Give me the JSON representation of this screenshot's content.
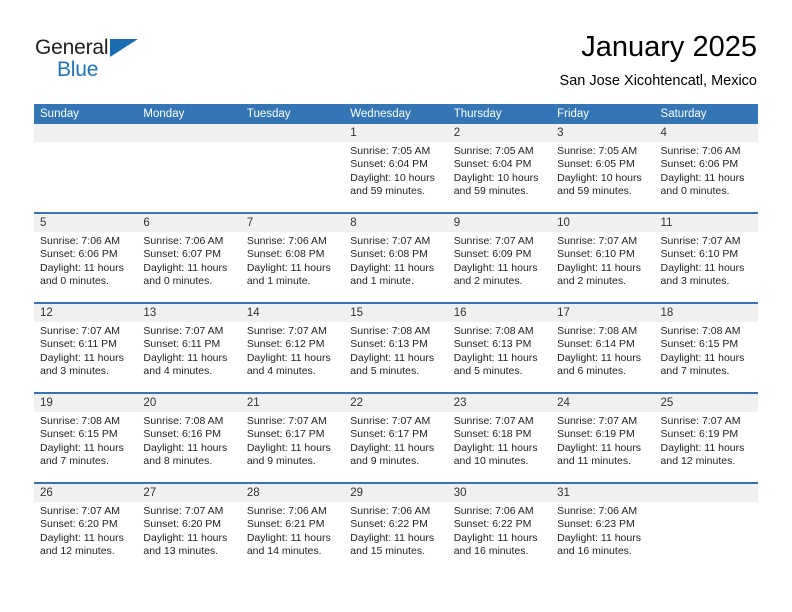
{
  "branding": {
    "name_part1": "General",
    "name_part2": "Blue",
    "triangle_color": "#1b6cb0",
    "blue_text_color": "#1b75bb"
  },
  "header": {
    "title": "January 2025",
    "subtitle": "San Jose Xicohtencatl, Mexico"
  },
  "theme": {
    "header_blue": "#3375b5",
    "daynum_band": "#f0f0f0",
    "text": "#222222"
  },
  "weekdays": [
    "Sunday",
    "Monday",
    "Tuesday",
    "Wednesday",
    "Thursday",
    "Friday",
    "Saturday"
  ],
  "weeks": [
    {
      "days": [
        {
          "num": "",
          "lines": []
        },
        {
          "num": "",
          "lines": []
        },
        {
          "num": "",
          "lines": []
        },
        {
          "num": "1",
          "lines": [
            "Sunrise: 7:05 AM",
            "Sunset: 6:04 PM",
            "Daylight: 10 hours",
            "and 59 minutes."
          ]
        },
        {
          "num": "2",
          "lines": [
            "Sunrise: 7:05 AM",
            "Sunset: 6:04 PM",
            "Daylight: 10 hours",
            "and 59 minutes."
          ]
        },
        {
          "num": "3",
          "lines": [
            "Sunrise: 7:05 AM",
            "Sunset: 6:05 PM",
            "Daylight: 10 hours",
            "and 59 minutes."
          ]
        },
        {
          "num": "4",
          "lines": [
            "Sunrise: 7:06 AM",
            "Sunset: 6:06 PM",
            "Daylight: 11 hours",
            "and 0 minutes."
          ]
        }
      ]
    },
    {
      "days": [
        {
          "num": "5",
          "lines": [
            "Sunrise: 7:06 AM",
            "Sunset: 6:06 PM",
            "Daylight: 11 hours",
            "and 0 minutes."
          ]
        },
        {
          "num": "6",
          "lines": [
            "Sunrise: 7:06 AM",
            "Sunset: 6:07 PM",
            "Daylight: 11 hours",
            "and 0 minutes."
          ]
        },
        {
          "num": "7",
          "lines": [
            "Sunrise: 7:06 AM",
            "Sunset: 6:08 PM",
            "Daylight: 11 hours",
            "and 1 minute."
          ]
        },
        {
          "num": "8",
          "lines": [
            "Sunrise: 7:07 AM",
            "Sunset: 6:08 PM",
            "Daylight: 11 hours",
            "and 1 minute."
          ]
        },
        {
          "num": "9",
          "lines": [
            "Sunrise: 7:07 AM",
            "Sunset: 6:09 PM",
            "Daylight: 11 hours",
            "and 2 minutes."
          ]
        },
        {
          "num": "10",
          "lines": [
            "Sunrise: 7:07 AM",
            "Sunset: 6:10 PM",
            "Daylight: 11 hours",
            "and 2 minutes."
          ]
        },
        {
          "num": "11",
          "lines": [
            "Sunrise: 7:07 AM",
            "Sunset: 6:10 PM",
            "Daylight: 11 hours",
            "and 3 minutes."
          ]
        }
      ]
    },
    {
      "days": [
        {
          "num": "12",
          "lines": [
            "Sunrise: 7:07 AM",
            "Sunset: 6:11 PM",
            "Daylight: 11 hours",
            "and 3 minutes."
          ]
        },
        {
          "num": "13",
          "lines": [
            "Sunrise: 7:07 AM",
            "Sunset: 6:11 PM",
            "Daylight: 11 hours",
            "and 4 minutes."
          ]
        },
        {
          "num": "14",
          "lines": [
            "Sunrise: 7:07 AM",
            "Sunset: 6:12 PM",
            "Daylight: 11 hours",
            "and 4 minutes."
          ]
        },
        {
          "num": "15",
          "lines": [
            "Sunrise: 7:08 AM",
            "Sunset: 6:13 PM",
            "Daylight: 11 hours",
            "and 5 minutes."
          ]
        },
        {
          "num": "16",
          "lines": [
            "Sunrise: 7:08 AM",
            "Sunset: 6:13 PM",
            "Daylight: 11 hours",
            "and 5 minutes."
          ]
        },
        {
          "num": "17",
          "lines": [
            "Sunrise: 7:08 AM",
            "Sunset: 6:14 PM",
            "Daylight: 11 hours",
            "and 6 minutes."
          ]
        },
        {
          "num": "18",
          "lines": [
            "Sunrise: 7:08 AM",
            "Sunset: 6:15 PM",
            "Daylight: 11 hours",
            "and 7 minutes."
          ]
        }
      ]
    },
    {
      "days": [
        {
          "num": "19",
          "lines": [
            "Sunrise: 7:08 AM",
            "Sunset: 6:15 PM",
            "Daylight: 11 hours",
            "and 7 minutes."
          ]
        },
        {
          "num": "20",
          "lines": [
            "Sunrise: 7:08 AM",
            "Sunset: 6:16 PM",
            "Daylight: 11 hours",
            "and 8 minutes."
          ]
        },
        {
          "num": "21",
          "lines": [
            "Sunrise: 7:07 AM",
            "Sunset: 6:17 PM",
            "Daylight: 11 hours",
            "and 9 minutes."
          ]
        },
        {
          "num": "22",
          "lines": [
            "Sunrise: 7:07 AM",
            "Sunset: 6:17 PM",
            "Daylight: 11 hours",
            "and 9 minutes."
          ]
        },
        {
          "num": "23",
          "lines": [
            "Sunrise: 7:07 AM",
            "Sunset: 6:18 PM",
            "Daylight: 11 hours",
            "and 10 minutes."
          ]
        },
        {
          "num": "24",
          "lines": [
            "Sunrise: 7:07 AM",
            "Sunset: 6:19 PM",
            "Daylight: 11 hours",
            "and 11 minutes."
          ]
        },
        {
          "num": "25",
          "lines": [
            "Sunrise: 7:07 AM",
            "Sunset: 6:19 PM",
            "Daylight: 11 hours",
            "and 12 minutes."
          ]
        }
      ]
    },
    {
      "days": [
        {
          "num": "26",
          "lines": [
            "Sunrise: 7:07 AM",
            "Sunset: 6:20 PM",
            "Daylight: 11 hours",
            "and 12 minutes."
          ]
        },
        {
          "num": "27",
          "lines": [
            "Sunrise: 7:07 AM",
            "Sunset: 6:20 PM",
            "Daylight: 11 hours",
            "and 13 minutes."
          ]
        },
        {
          "num": "28",
          "lines": [
            "Sunrise: 7:06 AM",
            "Sunset: 6:21 PM",
            "Daylight: 11 hours",
            "and 14 minutes."
          ]
        },
        {
          "num": "29",
          "lines": [
            "Sunrise: 7:06 AM",
            "Sunset: 6:22 PM",
            "Daylight: 11 hours",
            "and 15 minutes."
          ]
        },
        {
          "num": "30",
          "lines": [
            "Sunrise: 7:06 AM",
            "Sunset: 6:22 PM",
            "Daylight: 11 hours",
            "and 16 minutes."
          ]
        },
        {
          "num": "31",
          "lines": [
            "Sunrise: 7:06 AM",
            "Sunset: 6:23 PM",
            "Daylight: 11 hours",
            "and 16 minutes."
          ]
        },
        {
          "num": "",
          "lines": []
        }
      ]
    }
  ]
}
